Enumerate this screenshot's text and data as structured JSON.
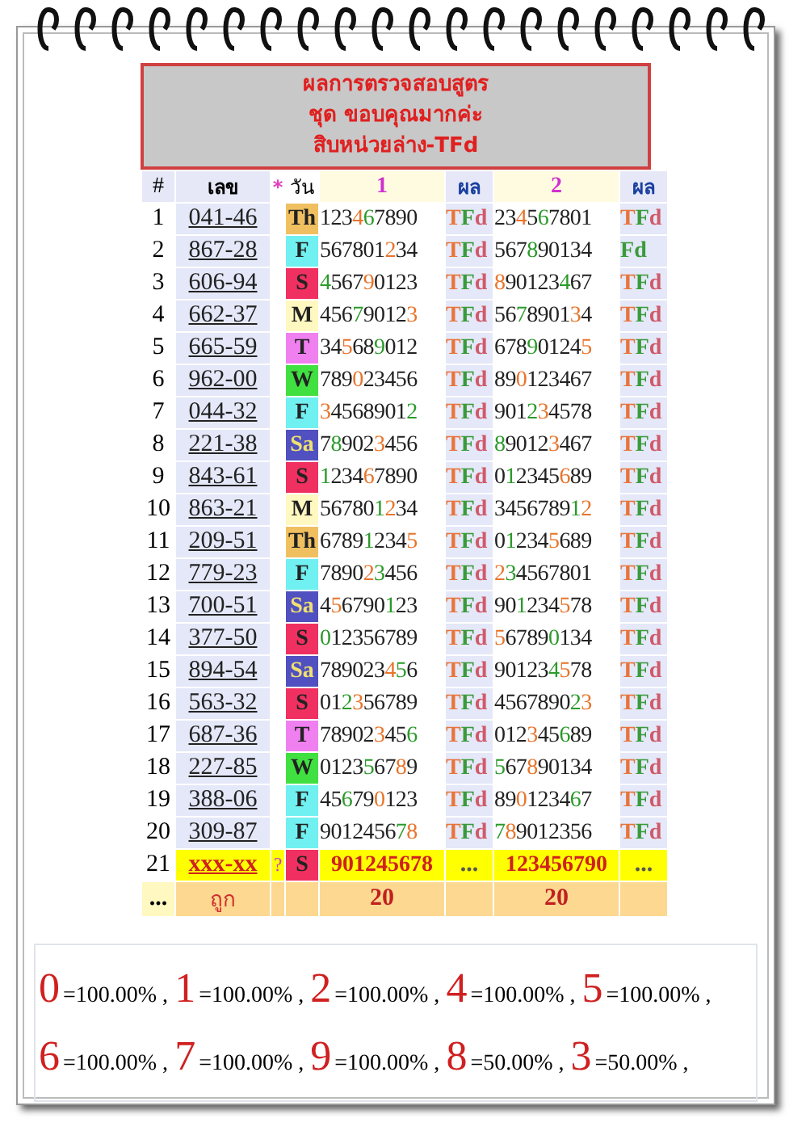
{
  "header": [
    "ผลการตรวจสอบสูตร",
    "ชุด ขอบคุณมากค่ะ",
    "สิบหน่วยล่าง-TFd"
  ],
  "columns": [
    "#",
    "เลข",
    "*",
    "วัน",
    "1",
    "ผล",
    "2",
    "ผล"
  ],
  "rows": [
    {
      "no": "1",
      "number": "041-46",
      "day": {
        "label": "Th",
        "color": "#f0c060"
      },
      "f1": [
        {
          "t": "123"
        },
        {
          "t": "4",
          "color": "#e8742a"
        },
        {
          "t": "6",
          "color": "#2a9a2a"
        },
        {
          "t": "7890"
        }
      ],
      "r1": [
        {
          "t": "T",
          "color": "#e8743a"
        },
        {
          "t": "F",
          "color": "#3a9a3a"
        },
        {
          "t": "d",
          "color": "#d05a6a"
        }
      ],
      "f2": [
        {
          "t": "23"
        },
        {
          "t": "4",
          "color": "#e8742a"
        },
        {
          "t": "5"
        },
        {
          "t": "6",
          "color": "#2a9a2a"
        },
        {
          "t": "7801"
        }
      ],
      "r2": [
        {
          "t": "T",
          "color": "#e8743a"
        },
        {
          "t": "F",
          "color": "#3a9a3a"
        },
        {
          "t": "d",
          "color": "#d05a6a"
        }
      ]
    },
    {
      "no": "2",
      "number": "867-28",
      "day": {
        "label": "F",
        "color": "#70f0f0"
      },
      "f1": [
        {
          "t": "567801"
        },
        {
          "t": "2",
          "color": "#e8742a"
        },
        {
          "t": "34"
        }
      ],
      "r1": [
        {
          "t": "T",
          "color": "#e8743a"
        },
        {
          "t": "F",
          "color": "#3a9a3a"
        },
        {
          "t": "d",
          "color": "#d05a6a"
        }
      ],
      "f2": [
        {
          "t": "567"
        },
        {
          "t": "8",
          "color": "#2a9a2a"
        },
        {
          "t": "90134"
        }
      ],
      "r2": [
        {
          "t": "F",
          "color": "#3a9a3a"
        },
        {
          "t": "d",
          "color": "#3a9a3a"
        }
      ]
    },
    {
      "no": "3",
      "number": "606-94",
      "day": {
        "label": "S",
        "color": "#f03060"
      },
      "f1": [
        {
          "t": "4",
          "color": "#2a9a2a"
        },
        {
          "t": "567"
        },
        {
          "t": "9",
          "color": "#e8742a"
        },
        {
          "t": "0123"
        }
      ],
      "r1": [
        {
          "t": "T",
          "color": "#e8743a"
        },
        {
          "t": "F",
          "color": "#3a9a3a"
        },
        {
          "t": "d",
          "color": "#d05a6a"
        }
      ],
      "f2": [
        {
          "t": "8",
          "color": "#e8742a"
        },
        {
          "t": "90123"
        },
        {
          "t": "4",
          "color": "#2a9a2a"
        },
        {
          "t": "67"
        }
      ],
      "r2": [
        {
          "t": "T",
          "color": "#e8743a"
        },
        {
          "t": "F",
          "color": "#3a9a3a"
        },
        {
          "t": "d",
          "color": "#d05a6a"
        }
      ]
    },
    {
      "no": "4",
      "number": "662-37",
      "day": {
        "label": "M",
        "color": "#fff8c0"
      },
      "f1": [
        {
          "t": "456"
        },
        {
          "t": "7",
          "color": "#2a9a2a"
        },
        {
          "t": "9012"
        },
        {
          "t": "3",
          "color": "#e8742a"
        }
      ],
      "r1": [
        {
          "t": "T",
          "color": "#e8743a"
        },
        {
          "t": "F",
          "color": "#3a9a3a"
        },
        {
          "t": "d",
          "color": "#d05a6a"
        }
      ],
      "f2": [
        {
          "t": "56"
        },
        {
          "t": "7",
          "color": "#2a9a2a"
        },
        {
          "t": "8901"
        },
        {
          "t": "3",
          "color": "#e8742a"
        },
        {
          "t": "4"
        }
      ],
      "r2": [
        {
          "t": "T",
          "color": "#e8743a"
        },
        {
          "t": "F",
          "color": "#3a9a3a"
        },
        {
          "t": "d",
          "color": "#d05a6a"
        }
      ]
    },
    {
      "no": "5",
      "number": "665-59",
      "day": {
        "label": "T",
        "color": "#f080f0"
      },
      "f1": [
        {
          "t": "34"
        },
        {
          "t": "5",
          "color": "#e8742a"
        },
        {
          "t": "68"
        },
        {
          "t": "9",
          "color": "#2a9a2a"
        },
        {
          "t": "012"
        }
      ],
      "r1": [
        {
          "t": "T",
          "color": "#e8743a"
        },
        {
          "t": "F",
          "color": "#3a9a3a"
        },
        {
          "t": "d",
          "color": "#d05a6a"
        }
      ],
      "f2": [
        {
          "t": "678"
        },
        {
          "t": "9",
          "color": "#2a9a2a"
        },
        {
          "t": "0124"
        },
        {
          "t": "5",
          "color": "#e8742a"
        }
      ],
      "r2": [
        {
          "t": "T",
          "color": "#e8743a"
        },
        {
          "t": "F",
          "color": "#3a9a3a"
        },
        {
          "t": "d",
          "color": "#d05a6a"
        }
      ]
    },
    {
      "no": "6",
      "number": "962-00",
      "day": {
        "label": "W",
        "color": "#40e040"
      },
      "f1": [
        {
          "t": "789"
        },
        {
          "t": "0",
          "color": "#e8742a"
        },
        {
          "t": "23456"
        }
      ],
      "r1": [
        {
          "t": "T",
          "color": "#e8743a"
        },
        {
          "t": "F",
          "color": "#3a9a3a"
        },
        {
          "t": "d",
          "color": "#d05a6a"
        }
      ],
      "f2": [
        {
          "t": "89"
        },
        {
          "t": "0",
          "color": "#e8742a"
        },
        {
          "t": "123467"
        }
      ],
      "r2": [
        {
          "t": "T",
          "color": "#e8743a"
        },
        {
          "t": "F",
          "color": "#3a9a3a"
        },
        {
          "t": "d",
          "color": "#d05a6a"
        }
      ]
    },
    {
      "no": "7",
      "number": "044-32",
      "day": {
        "label": "F",
        "color": "#70f0f0"
      },
      "f1": [
        {
          "t": "3",
          "color": "#e8742a"
        },
        {
          "t": "4568901"
        },
        {
          "t": "2",
          "color": "#2a9a2a"
        }
      ],
      "r1": [
        {
          "t": "T",
          "color": "#e8743a"
        },
        {
          "t": "F",
          "color": "#3a9a3a"
        },
        {
          "t": "d",
          "color": "#d05a6a"
        }
      ],
      "f2": [
        {
          "t": "901"
        },
        {
          "t": "2",
          "color": "#2a9a2a"
        },
        {
          "t": "3",
          "color": "#e8742a"
        },
        {
          "t": "4578"
        }
      ],
      "r2": [
        {
          "t": "T",
          "color": "#e8743a"
        },
        {
          "t": "F",
          "color": "#3a9a3a"
        },
        {
          "t": "d",
          "color": "#d05a6a"
        }
      ]
    },
    {
      "no": "8",
      "number": "221-38",
      "day": {
        "label": "Sa",
        "color": "#5050c0"
      },
      "f1": [
        {
          "t": "7"
        },
        {
          "t": "8",
          "color": "#2a9a2a"
        },
        {
          "t": "902"
        },
        {
          "t": "3",
          "color": "#e8742a"
        },
        {
          "t": "456"
        }
      ],
      "r1": [
        {
          "t": "T",
          "color": "#e8743a"
        },
        {
          "t": "F",
          "color": "#3a9a3a"
        },
        {
          "t": "d",
          "color": "#d05a6a"
        }
      ],
      "f2": [
        {
          "t": "8",
          "color": "#2a9a2a"
        },
        {
          "t": "9012"
        },
        {
          "t": "3",
          "color": "#e8742a"
        },
        {
          "t": "467"
        }
      ],
      "r2": [
        {
          "t": "T",
          "color": "#e8743a"
        },
        {
          "t": "F",
          "color": "#3a9a3a"
        },
        {
          "t": "d",
          "color": "#d05a6a"
        }
      ]
    },
    {
      "no": "9",
      "number": "843-61",
      "day": {
        "label": "S",
        "color": "#f03060"
      },
      "f1": [
        {
          "t": "1",
          "color": "#2a9a2a"
        },
        {
          "t": "234"
        },
        {
          "t": "6",
          "color": "#e8742a"
        },
        {
          "t": "7890"
        }
      ],
      "r1": [
        {
          "t": "T",
          "color": "#e8743a"
        },
        {
          "t": "F",
          "color": "#3a9a3a"
        },
        {
          "t": "d",
          "color": "#d05a6a"
        }
      ],
      "f2": [
        {
          "t": "0"
        },
        {
          "t": "1",
          "color": "#2a9a2a"
        },
        {
          "t": "2345"
        },
        {
          "t": "6",
          "color": "#e8742a"
        },
        {
          "t": "89"
        }
      ],
      "r2": [
        {
          "t": "T",
          "color": "#e8743a"
        },
        {
          "t": "F",
          "color": "#3a9a3a"
        },
        {
          "t": "d",
          "color": "#d05a6a"
        }
      ]
    },
    {
      "no": "10",
      "number": "863-21",
      "day": {
        "label": "M",
        "color": "#fff8c0"
      },
      "f1": [
        {
          "t": "56780"
        },
        {
          "t": "1",
          "color": "#2a9a2a"
        },
        {
          "t": "2",
          "color": "#e8742a"
        },
        {
          "t": "34"
        }
      ],
      "r1": [
        {
          "t": "T",
          "color": "#e8743a"
        },
        {
          "t": "F",
          "color": "#3a9a3a"
        },
        {
          "t": "d",
          "color": "#d05a6a"
        }
      ],
      "f2": [
        {
          "t": "3456789"
        },
        {
          "t": "1",
          "color": "#2a9a2a"
        },
        {
          "t": "2",
          "color": "#e8742a"
        }
      ],
      "r2": [
        {
          "t": "T",
          "color": "#e8743a"
        },
        {
          "t": "F",
          "color": "#3a9a3a"
        },
        {
          "t": "d",
          "color": "#d05a6a"
        }
      ]
    },
    {
      "no": "11",
      "number": "209-51",
      "day": {
        "label": "Th",
        "color": "#f0c060"
      },
      "f1": [
        {
          "t": "6789"
        },
        {
          "t": "1",
          "color": "#2a9a2a"
        },
        {
          "t": "234"
        },
        {
          "t": "5",
          "color": "#e8742a"
        }
      ],
      "r1": [
        {
          "t": "T",
          "color": "#e8743a"
        },
        {
          "t": "F",
          "color": "#3a9a3a"
        },
        {
          "t": "d",
          "color": "#d05a6a"
        }
      ],
      "f2": [
        {
          "t": "0"
        },
        {
          "t": "1",
          "color": "#2a9a2a"
        },
        {
          "t": "234"
        },
        {
          "t": "5",
          "color": "#e8742a"
        },
        {
          "t": "689"
        }
      ],
      "r2": [
        {
          "t": "T",
          "color": "#e8743a"
        },
        {
          "t": "F",
          "color": "#3a9a3a"
        },
        {
          "t": "d",
          "color": "#d05a6a"
        }
      ]
    },
    {
      "no": "12",
      "number": "779-23",
      "day": {
        "label": "F",
        "color": "#70f0f0"
      },
      "f1": [
        {
          "t": "7890"
        },
        {
          "t": "2",
          "color": "#e8742a"
        },
        {
          "t": "3",
          "color": "#2a9a2a"
        },
        {
          "t": "456"
        }
      ],
      "r1": [
        {
          "t": "T",
          "color": "#e8743a"
        },
        {
          "t": "F",
          "color": "#3a9a3a"
        },
        {
          "t": "d",
          "color": "#d05a6a"
        }
      ],
      "f2": [
        {
          "t": "2",
          "color": "#e8742a"
        },
        {
          "t": "3",
          "color": "#2a9a2a"
        },
        {
          "t": "4567801"
        }
      ],
      "r2": [
        {
          "t": "T",
          "color": "#e8743a"
        },
        {
          "t": "F",
          "color": "#3a9a3a"
        },
        {
          "t": "d",
          "color": "#d05a6a"
        }
      ]
    },
    {
      "no": "13",
      "number": "700-51",
      "day": {
        "label": "Sa",
        "color": "#5050c0"
      },
      "f1": [
        {
          "t": "4"
        },
        {
          "t": "5",
          "color": "#e8742a"
        },
        {
          "t": "6790"
        },
        {
          "t": "1",
          "color": "#2a9a2a"
        },
        {
          "t": "23"
        }
      ],
      "r1": [
        {
          "t": "T",
          "color": "#e8743a"
        },
        {
          "t": "F",
          "color": "#3a9a3a"
        },
        {
          "t": "d",
          "color": "#d05a6a"
        }
      ],
      "f2": [
        {
          "t": "90"
        },
        {
          "t": "1",
          "color": "#2a9a2a"
        },
        {
          "t": "234"
        },
        {
          "t": "5",
          "color": "#e8742a"
        },
        {
          "t": "78"
        }
      ],
      "r2": [
        {
          "t": "T",
          "color": "#e8743a"
        },
        {
          "t": "F",
          "color": "#3a9a3a"
        },
        {
          "t": "d",
          "color": "#d05a6a"
        }
      ]
    },
    {
      "no": "14",
      "number": "377-50",
      "day": {
        "label": "S",
        "color": "#f03060"
      },
      "f1": [
        {
          "t": "0",
          "color": "#2a9a2a"
        },
        {
          "t": "12356789"
        }
      ],
      "r1": [
        {
          "t": "T",
          "color": "#e8743a"
        },
        {
          "t": "F",
          "color": "#3a9a3a"
        },
        {
          "t": "d",
          "color": "#d05a6a"
        }
      ],
      "f2": [
        {
          "t": "5",
          "color": "#e8742a"
        },
        {
          "t": "6789"
        },
        {
          "t": "0",
          "color": "#2a9a2a"
        },
        {
          "t": "134"
        }
      ],
      "r2": [
        {
          "t": "T",
          "color": "#e8743a"
        },
        {
          "t": "F",
          "color": "#3a9a3a"
        },
        {
          "t": "d",
          "color": "#d05a6a"
        }
      ]
    },
    {
      "no": "15",
      "number": "894-54",
      "day": {
        "label": "Sa",
        "color": "#5050c0"
      },
      "f1": [
        {
          "t": "789023"
        },
        {
          "t": "4",
          "color": "#e8742a"
        },
        {
          "t": "5",
          "color": "#2a9a2a"
        },
        {
          "t": "6"
        }
      ],
      "r1": [
        {
          "t": "T",
          "color": "#e8743a"
        },
        {
          "t": "F",
          "color": "#3a9a3a"
        },
        {
          "t": "d",
          "color": "#d05a6a"
        }
      ],
      "f2": [
        {
          "t": "90123"
        },
        {
          "t": "4",
          "color": "#2a9a2a"
        },
        {
          "t": "5",
          "color": "#e8742a"
        },
        {
          "t": "78"
        }
      ],
      "r2": [
        {
          "t": "T",
          "color": "#e8743a"
        },
        {
          "t": "F",
          "color": "#3a9a3a"
        },
        {
          "t": "d",
          "color": "#d05a6a"
        }
      ]
    },
    {
      "no": "16",
      "number": "563-32",
      "day": {
        "label": "S",
        "color": "#f03060"
      },
      "f1": [
        {
          "t": "01"
        },
        {
          "t": "2",
          "color": "#2a9a2a"
        },
        {
          "t": "3",
          "color": "#e8742a"
        },
        {
          "t": "56789"
        }
      ],
      "r1": [
        {
          "t": "T",
          "color": "#e8743a"
        },
        {
          "t": "F",
          "color": "#3a9a3a"
        },
        {
          "t": "d",
          "color": "#d05a6a"
        }
      ],
      "f2": [
        {
          "t": "4567890"
        },
        {
          "t": "2",
          "color": "#2a9a2a"
        },
        {
          "t": "3",
          "color": "#e8742a"
        }
      ],
      "r2": [
        {
          "t": "T",
          "color": "#e8743a"
        },
        {
          "t": "F",
          "color": "#3a9a3a"
        },
        {
          "t": "d",
          "color": "#d05a6a"
        }
      ]
    },
    {
      "no": "17",
      "number": "687-36",
      "day": {
        "label": "T",
        "color": "#f080f0"
      },
      "f1": [
        {
          "t": "78902"
        },
        {
          "t": "3",
          "color": "#e8742a"
        },
        {
          "t": "45"
        },
        {
          "t": "6",
          "color": "#2a9a2a"
        }
      ],
      "r1": [
        {
          "t": "T",
          "color": "#e8743a"
        },
        {
          "t": "F",
          "color": "#3a9a3a"
        },
        {
          "t": "d",
          "color": "#d05a6a"
        }
      ],
      "f2": [
        {
          "t": "012"
        },
        {
          "t": "3",
          "color": "#e8742a"
        },
        {
          "t": "45"
        },
        {
          "t": "6",
          "color": "#2a9a2a"
        },
        {
          "t": "89"
        }
      ],
      "r2": [
        {
          "t": "T",
          "color": "#e8743a"
        },
        {
          "t": "F",
          "color": "#3a9a3a"
        },
        {
          "t": "d",
          "color": "#d05a6a"
        }
      ]
    },
    {
      "no": "18",
      "number": "227-85",
      "day": {
        "label": "W",
        "color": "#40e040"
      },
      "f1": [
        {
          "t": "0123"
        },
        {
          "t": "5",
          "color": "#2a9a2a"
        },
        {
          "t": "67"
        },
        {
          "t": "8",
          "color": "#e8742a"
        },
        {
          "t": "9"
        }
      ],
      "r1": [
        {
          "t": "T",
          "color": "#e8743a"
        },
        {
          "t": "F",
          "color": "#3a9a3a"
        },
        {
          "t": "d",
          "color": "#d05a6a"
        }
      ],
      "f2": [
        {
          "t": "5",
          "color": "#2a9a2a"
        },
        {
          "t": "67"
        },
        {
          "t": "8",
          "color": "#e8742a"
        },
        {
          "t": "90134"
        }
      ],
      "r2": [
        {
          "t": "T",
          "color": "#e8743a"
        },
        {
          "t": "F",
          "color": "#3a9a3a"
        },
        {
          "t": "d",
          "color": "#d05a6a"
        }
      ]
    },
    {
      "no": "19",
      "number": "388-06",
      "day": {
        "label": "F",
        "color": "#70f0f0"
      },
      "f1": [
        {
          "t": "45"
        },
        {
          "t": "6",
          "color": "#2a9a2a"
        },
        {
          "t": "79"
        },
        {
          "t": "0",
          "color": "#e8742a"
        },
        {
          "t": "123"
        }
      ],
      "r1": [
        {
          "t": "T",
          "color": "#e8743a"
        },
        {
          "t": "F",
          "color": "#3a9a3a"
        },
        {
          "t": "d",
          "color": "#d05a6a"
        }
      ],
      "f2": [
        {
          "t": "89"
        },
        {
          "t": "0",
          "color": "#e8742a"
        },
        {
          "t": "1234"
        },
        {
          "t": "6",
          "color": "#2a9a2a"
        },
        {
          "t": "7"
        }
      ],
      "r2": [
        {
          "t": "T",
          "color": "#e8743a"
        },
        {
          "t": "F",
          "color": "#3a9a3a"
        },
        {
          "t": "d",
          "color": "#d05a6a"
        }
      ]
    },
    {
      "no": "20",
      "number": "309-87",
      "day": {
        "label": "F",
        "color": "#70f0f0"
      },
      "f1": [
        {
          "t": "9012456"
        },
        {
          "t": "7",
          "color": "#2a9a2a"
        },
        {
          "t": "8",
          "color": "#e8742a"
        }
      ],
      "r1": [
        {
          "t": "T",
          "color": "#e8743a"
        },
        {
          "t": "F",
          "color": "#3a9a3a"
        },
        {
          "t": "d",
          "color": "#d05a6a"
        }
      ],
      "f2": [
        {
          "t": "7",
          "color": "#2a9a2a"
        },
        {
          "t": "8",
          "color": "#e8742a"
        },
        {
          "t": "9012356"
        }
      ],
      "r2": [
        {
          "t": "T",
          "color": "#e8743a"
        },
        {
          "t": "F",
          "color": "#3a9a3a"
        },
        {
          "t": "d",
          "color": "#d05a6a"
        }
      ]
    }
  ],
  "pending": {
    "no": "21",
    "number": "xxx-xx",
    "mark": "?",
    "day": {
      "label": "S",
      "color": "#f03060"
    },
    "f1": "901245678",
    "r1": "...",
    "f2": "123456790",
    "r2": "..."
  },
  "footer": {
    "no": "...",
    "label": "ถูก",
    "c1": "20",
    "c2": "20"
  },
  "stats": [
    [
      {
        "digit": "0",
        "value": "=100.00% ,"
      },
      {
        "digit": "1",
        "value": "=100.00% ,"
      },
      {
        "digit": "2",
        "value": "=100.00% ,"
      },
      {
        "digit": "4",
        "value": "=100.00% ,"
      },
      {
        "digit": "5",
        "value": "=100.00% ,"
      }
    ],
    [
      {
        "digit": "6",
        "value": "=100.00% ,"
      },
      {
        "digit": "7",
        "value": "=100.00% ,"
      },
      {
        "digit": "9",
        "value": "=100.00% ,"
      },
      {
        "digit": "8",
        "value": "=50.00% ,"
      },
      {
        "digit": "3",
        "value": "=50.00% ,"
      }
    ]
  ]
}
